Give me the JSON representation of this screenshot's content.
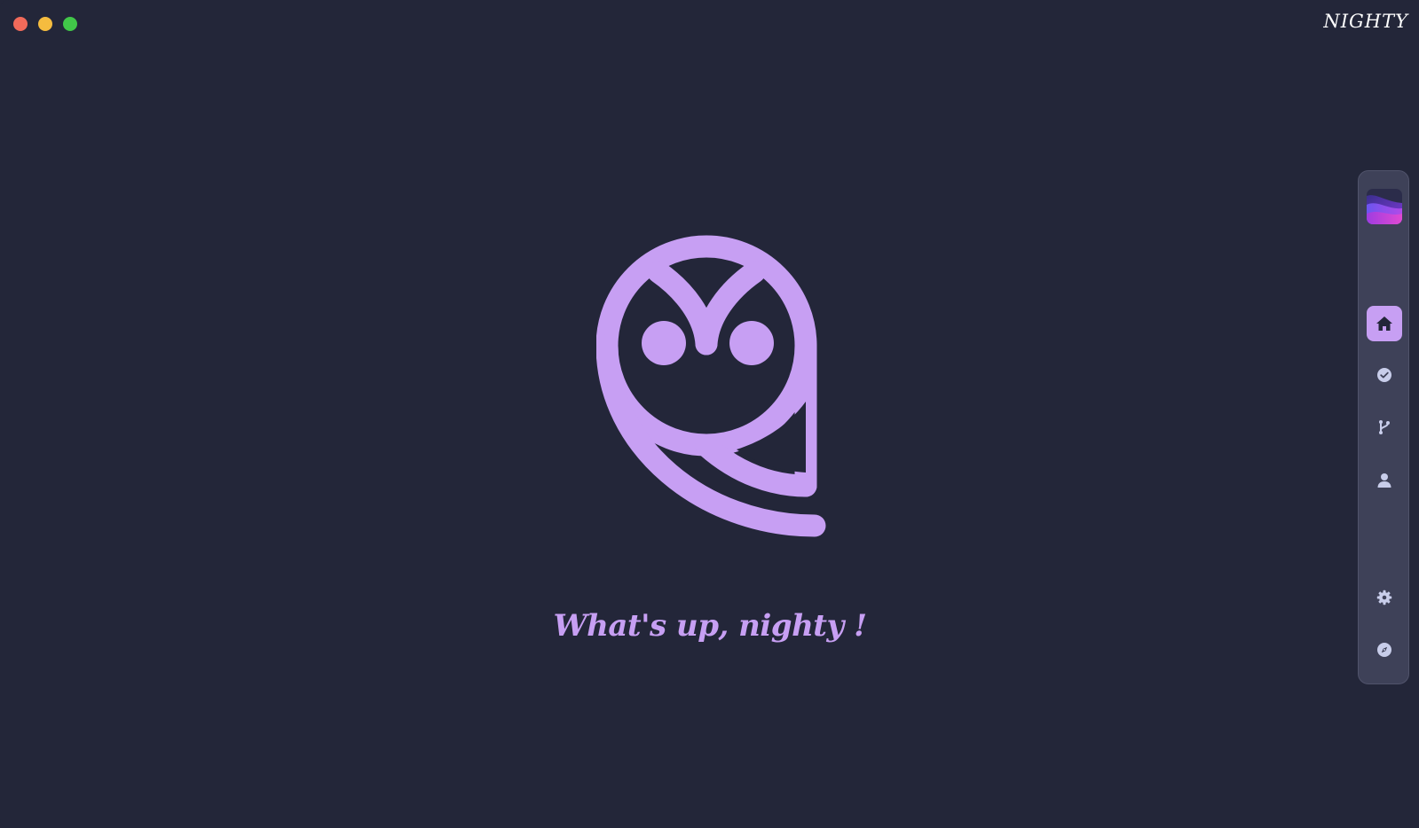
{
  "app": {
    "brand": "NIGHTY"
  },
  "main": {
    "greeting": "What's up, nighty !"
  },
  "colors": {
    "background": "#232639",
    "accent": "#c79ff3",
    "dock": "#3e4158",
    "icon": "#c8cdea"
  },
  "dock": {
    "items": [
      {
        "icon": "home-icon",
        "active": true
      },
      {
        "icon": "check-circle-icon",
        "active": false
      },
      {
        "icon": "git-branch-icon",
        "active": false
      },
      {
        "icon": "user-icon",
        "active": false
      },
      {
        "icon": "gear-icon",
        "active": false
      },
      {
        "icon": "compass-icon",
        "active": false
      }
    ]
  }
}
